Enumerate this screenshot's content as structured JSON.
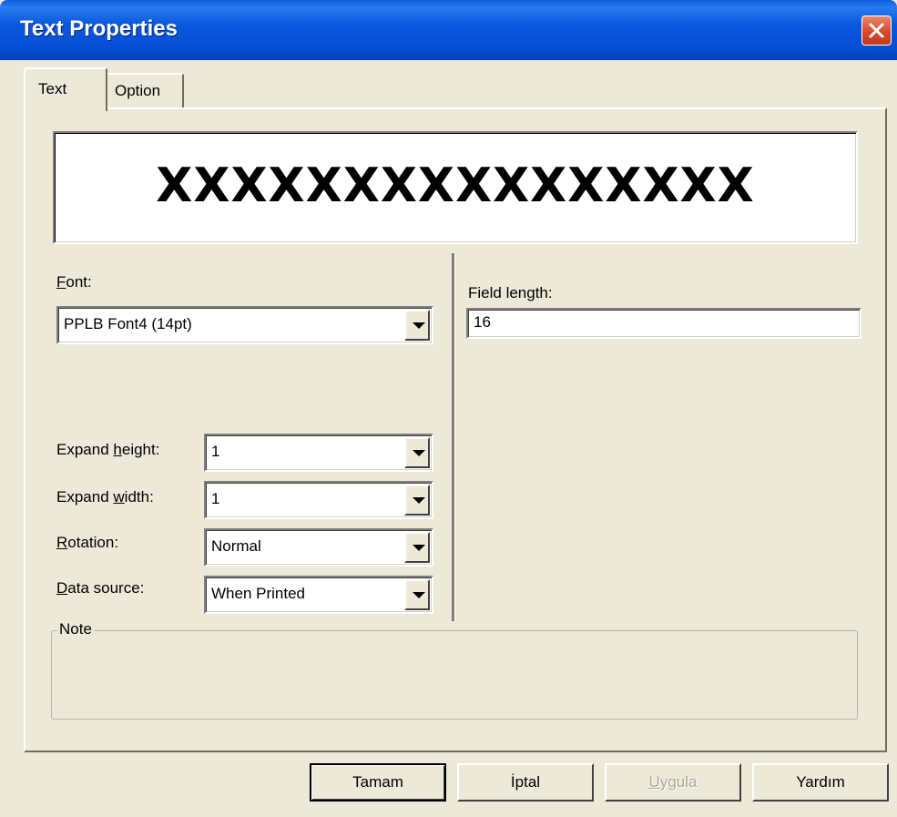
{
  "window": {
    "title": "Text Properties"
  },
  "tabs": [
    {
      "label": "Text",
      "selected": true
    },
    {
      "label": "Option",
      "selected": false
    }
  ],
  "preview": {
    "text": "XXXXXXXXXXXXXXXX"
  },
  "font": {
    "label_mnemonic": "F",
    "label_rest": "ont:",
    "value": "PPLB Font4 (14pt)"
  },
  "field_length": {
    "label": "Field length:",
    "value": "16"
  },
  "expand_height": {
    "label_pre": "Expand ",
    "label_mnemonic": "h",
    "label_post": "eight:",
    "value": "1"
  },
  "expand_width": {
    "label_pre": "Expand ",
    "label_mnemonic": "w",
    "label_post": "idth:",
    "value": "1"
  },
  "rotation": {
    "label_mnemonic": "R",
    "label_rest": "otation:",
    "value": "Normal"
  },
  "data_source": {
    "label_mnemonic": "D",
    "label_rest": "ata source:",
    "value": "When Printed"
  },
  "note": {
    "label": "Note",
    "value": ""
  },
  "buttons": {
    "ok": "Tamam",
    "cancel": "İptal",
    "apply_mnemonic": "U",
    "apply_rest": "ygula",
    "help": "Yardım"
  },
  "colors": {
    "titlebar": "#0a58dc",
    "face": "#ece9d8",
    "close": "#d8472a"
  },
  "icons": {
    "close": "close-icon",
    "dropdown": "chevron-down-icon"
  }
}
